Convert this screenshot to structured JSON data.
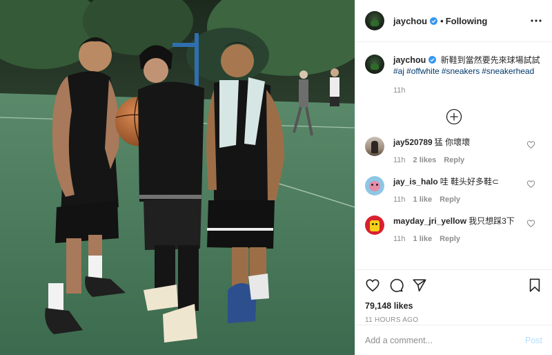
{
  "header": {
    "username": "jaychou",
    "separator": "•",
    "follow_label": "Following"
  },
  "caption": {
    "username": "jaychou",
    "text": "新鞋到當然要先來球場試試",
    "hashtags": [
      "#aj",
      "#offwhite",
      "#sneakers",
      "#sneakerhead"
    ],
    "time": "11h"
  },
  "comments": [
    {
      "username": "jay520789",
      "text": "猛 你壞壞",
      "time": "11h",
      "likes": "2 likes",
      "reply": "Reply"
    },
    {
      "username": "jay_is_halo",
      "text": "哇 鞋头好多鞋⊂",
      "time": "11h",
      "likes": "1 like",
      "reply": "Reply"
    },
    {
      "username": "mayday_jri_yellow",
      "text": "我只想踩3下",
      "time": "11h",
      "likes": "1 like",
      "reply": "Reply"
    }
  ],
  "footer": {
    "likes": "79,148 likes",
    "time_ago": "11 HOURS AGO",
    "comment_placeholder": "Add a comment...",
    "post_label": "Post"
  },
  "icons": {
    "verified": "verified-badge-icon",
    "more": "more-options-icon",
    "load_more": "load-more-comments-icon",
    "like": "heart-icon",
    "comment": "comment-icon",
    "share": "share-icon",
    "save": "bookmark-icon"
  },
  "colors": {
    "verified_blue": "#3897f0",
    "hashtag": "#00376b",
    "muted": "#8e8e8e",
    "post_button": "#b2dffc"
  }
}
